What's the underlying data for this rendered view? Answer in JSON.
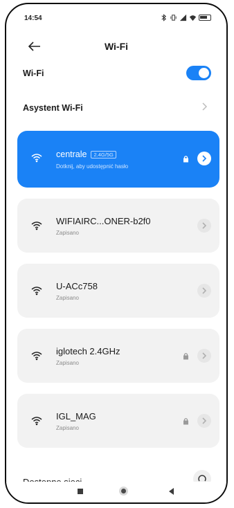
{
  "status_bar": {
    "time": "14:54"
  },
  "header": {
    "title": "Wi-Fi"
  },
  "wifi_toggle": {
    "label": "Wi-Fi",
    "on": true
  },
  "assistant": {
    "label": "Asystent Wi-Fi"
  },
  "networks": [
    {
      "ssid": "centrale",
      "badge": "2.4G/5G",
      "subtitle": "Dotknij, aby udostępnić hasło",
      "connected": true,
      "locked": true
    },
    {
      "ssid": "WIFIAIRC...ONER-b2f0",
      "subtitle": "Zapisano",
      "connected": false,
      "locked": false
    },
    {
      "ssid": "U-ACc758",
      "subtitle": "Zapisano",
      "connected": false,
      "locked": false
    },
    {
      "ssid": "iglotech 2.4GHz",
      "subtitle": "Zapisano",
      "connected": false,
      "locked": true
    },
    {
      "ssid": "IGL_MAG",
      "subtitle": "Zapisano",
      "connected": false,
      "locked": true
    }
  ],
  "available_section": {
    "label": "Dostępne sieci"
  },
  "colors": {
    "accent": "#1a82f6",
    "card_bg": "#f2f2f2"
  }
}
